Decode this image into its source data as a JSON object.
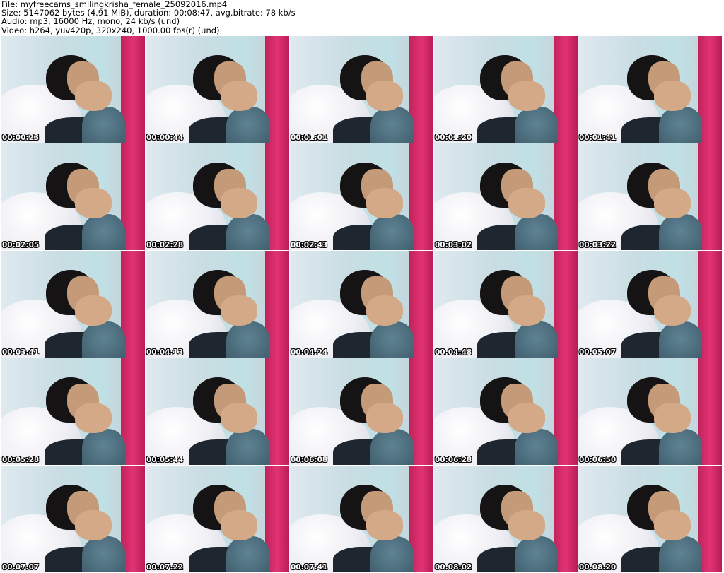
{
  "info": {
    "file": "File: myfreecams_smilingkrisha_female_25092016.mp4",
    "size": "Size: 5147062 bytes (4.91 MiB), duration: 00:08:47, avg.bitrate: 78 kb/s",
    "audio": "Audio: mp3, 16000 Hz, mono, 24 kb/s (und)",
    "video": "Video: h264, yuv420p, 320x240, 1000.00 fps(r) (und)"
  },
  "thumbnails": [
    "00:00:23",
    "00:00:44",
    "00:01:01",
    "00:01:20",
    "00:01:41",
    "00:02:05",
    "00:02:28",
    "00:02:43",
    "00:03:02",
    "00:03:22",
    "00:03:41",
    "00:04:13",
    "00:04:24",
    "00:04:48",
    "00:05:07",
    "00:05:28",
    "00:05:44",
    "00:06:08",
    "00:06:28",
    "00:06:50",
    "00:07:07",
    "00:07:22",
    "00:07:41",
    "00:08:02",
    "00:08:20"
  ]
}
